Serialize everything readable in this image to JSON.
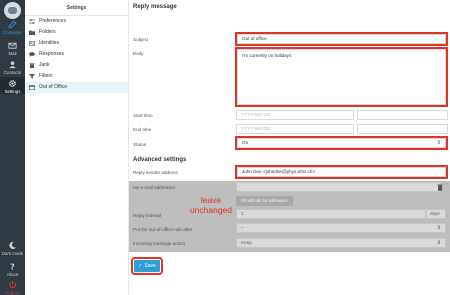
{
  "rail": {
    "items": [
      {
        "label": "Compose",
        "icon": "compose-icon"
      },
      {
        "label": "Mail",
        "icon": "mail-icon"
      },
      {
        "label": "Contacts",
        "icon": "contacts-icon"
      },
      {
        "label": "Settings",
        "icon": "gear-icon"
      }
    ],
    "bottom": [
      {
        "label": "Dark mode",
        "icon": "moon-icon"
      },
      {
        "label": "About",
        "icon": "question-icon"
      },
      {
        "label": "Logout",
        "icon": "power-icon"
      }
    ]
  },
  "settings_list": {
    "title": "Settings",
    "items": [
      {
        "label": "Preferences",
        "icon": "sliders-icon"
      },
      {
        "label": "Folders",
        "icon": "folder-icon"
      },
      {
        "label": "Identities",
        "icon": "id-card-icon"
      },
      {
        "label": "Responses",
        "icon": "comment-icon"
      },
      {
        "label": "Junk",
        "icon": "trash-icon"
      },
      {
        "label": "Filters",
        "icon": "filter-icon"
      },
      {
        "label": "Out of Office",
        "icon": "calendar-icon"
      }
    ],
    "selected": "Out of Office"
  },
  "reply": {
    "title": "Reply message",
    "subject_label": "Subject",
    "subject_value": "Out of office",
    "body_label": "Body",
    "body_value": "I'm currently on holidays"
  },
  "dates": {
    "start_label": "Start time",
    "start_placeholder": "YYYY-MM-DD",
    "end_label": "End time",
    "end_placeholder": "YYYY-MM-DD"
  },
  "status": {
    "label": "Status",
    "value": "On"
  },
  "advanced": {
    "title": "Advanced settings",
    "sender_label": "Reply sender address",
    "sender_value": "John Doe <johndoe@phys.ethz.ch>",
    "my_addresses_label": "My e-mail addresses",
    "fill_button": "Fill with all my addresses",
    "interval_label": "Reply interval",
    "interval_value": "1",
    "interval_unit": "days",
    "after_label": "Put the out-of-office rule after",
    "after_value": "--",
    "action_label": "Incoming message action",
    "action_value": "Keep"
  },
  "annotation": {
    "note_line1": "leave",
    "note_line2": "unchanged"
  },
  "save_label": "Save",
  "colors": {
    "accent": "#2f9ed6",
    "highlight_red": "#e03323",
    "rail": "#2f3a43"
  }
}
